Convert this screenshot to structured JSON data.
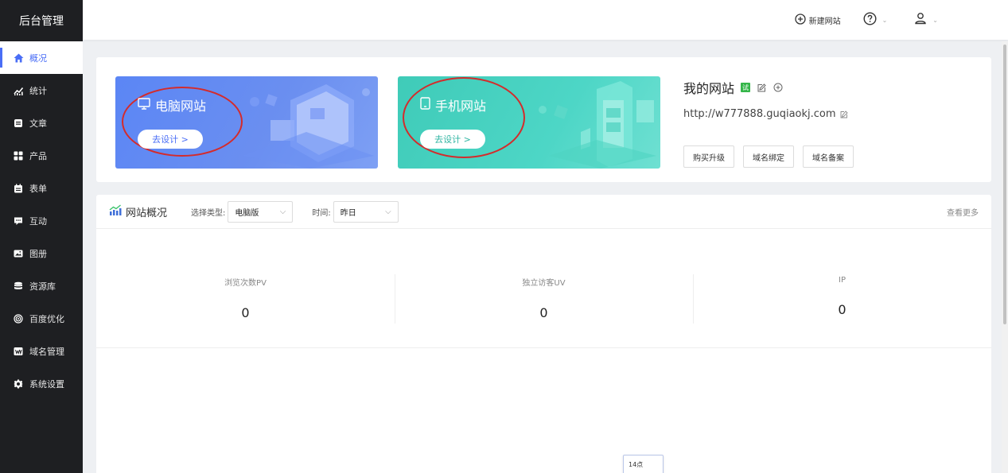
{
  "sidebar": {
    "logo": "后台管理",
    "items": [
      {
        "label": "概况",
        "icon": "home-icon"
      },
      {
        "label": "统计",
        "icon": "trend-icon"
      },
      {
        "label": "文章",
        "icon": "article-icon"
      },
      {
        "label": "产品",
        "icon": "grid-icon"
      },
      {
        "label": "表单",
        "icon": "form-icon"
      },
      {
        "label": "互动",
        "icon": "chat-icon"
      },
      {
        "label": "图册",
        "icon": "album-icon"
      },
      {
        "label": "资源库",
        "icon": "database-icon"
      },
      {
        "label": "百度优化",
        "icon": "target-icon"
      },
      {
        "label": "域名管理",
        "icon": "domain-icon"
      },
      {
        "label": "系统设置",
        "icon": "gear-icon"
      }
    ]
  },
  "topbar": {
    "new_site": "新建网站"
  },
  "site": {
    "pc_title": "电脑网站",
    "pc_button": "去设计 >",
    "mobile_title": "手机网站",
    "mobile_button": "去设计 >",
    "name": "我的网站",
    "trial_badge": "试",
    "url": "http://w777888.guqiaokj.com",
    "buttons": [
      "购买升级",
      "域名绑定",
      "域名备案"
    ]
  },
  "overview": {
    "title": "网站概况",
    "type_label": "选择类型:",
    "type_value": "电脑版",
    "time_label": "时间:",
    "time_value": "昨日",
    "more": "查看更多",
    "stats": [
      {
        "label": "浏览次数PV",
        "value": "0"
      },
      {
        "label": "独立访客UV",
        "value": "0"
      },
      {
        "label": "IP",
        "value": "0"
      }
    ],
    "tooltip_time": "14点"
  },
  "colors": {
    "accent": "#4a6ef6",
    "sidebar_bg": "#1e1f22",
    "pc_banner": "#5b86f5",
    "mobile_banner": "#46d0bf",
    "annotation_ring": "#d42b2b",
    "trial_badge": "#35b64a"
  }
}
